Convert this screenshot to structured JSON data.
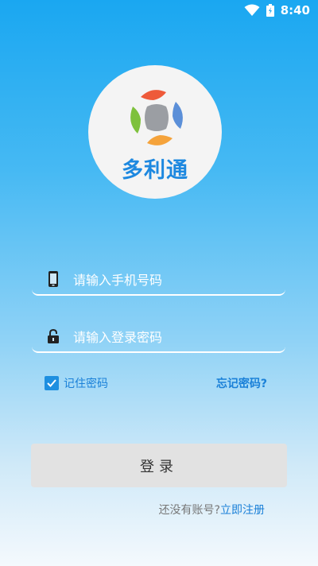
{
  "status_bar": {
    "time": "8:40"
  },
  "logo": {
    "brand_name": "多利通"
  },
  "form": {
    "phone_placeholder": "请输入手机号码",
    "password_placeholder": "请输入登录密码",
    "remember_label": "记住密码",
    "remember_checked": true,
    "forgot_label": "忘记密码?",
    "login_label": "登录"
  },
  "footer": {
    "question": "还没有账号?",
    "register_link": "立即注册"
  },
  "colors": {
    "accent": "#1a80d8",
    "logo_text": "#1d88e0",
    "button_bg": "#e2e2e2"
  }
}
